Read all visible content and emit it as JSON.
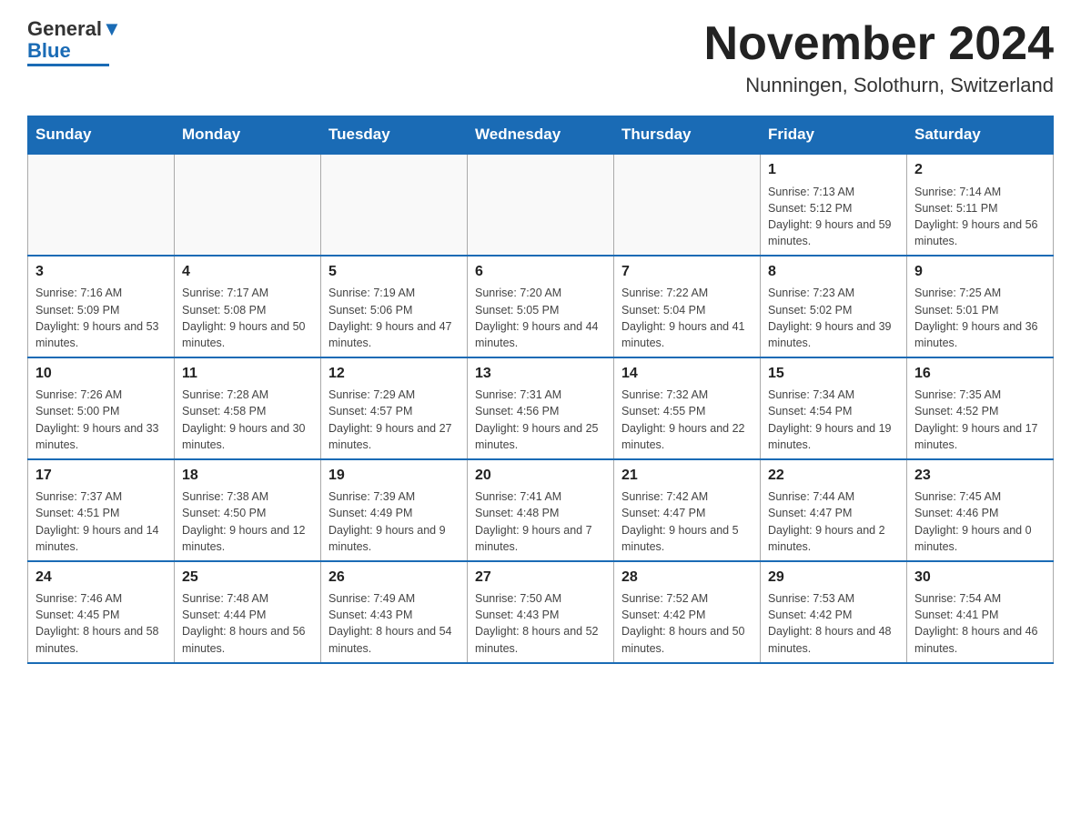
{
  "header": {
    "logo_text_black": "General",
    "logo_text_blue": "Blue",
    "month_title": "November 2024",
    "location": "Nunningen, Solothurn, Switzerland"
  },
  "weekdays": [
    "Sunday",
    "Monday",
    "Tuesday",
    "Wednesday",
    "Thursday",
    "Friday",
    "Saturday"
  ],
  "weeks": [
    [
      {
        "day": "",
        "sunrise": "",
        "sunset": "",
        "daylight": ""
      },
      {
        "day": "",
        "sunrise": "",
        "sunset": "",
        "daylight": ""
      },
      {
        "day": "",
        "sunrise": "",
        "sunset": "",
        "daylight": ""
      },
      {
        "day": "",
        "sunrise": "",
        "sunset": "",
        "daylight": ""
      },
      {
        "day": "",
        "sunrise": "",
        "sunset": "",
        "daylight": ""
      },
      {
        "day": "1",
        "sunrise": "Sunrise: 7:13 AM",
        "sunset": "Sunset: 5:12 PM",
        "daylight": "Daylight: 9 hours and 59 minutes."
      },
      {
        "day": "2",
        "sunrise": "Sunrise: 7:14 AM",
        "sunset": "Sunset: 5:11 PM",
        "daylight": "Daylight: 9 hours and 56 minutes."
      }
    ],
    [
      {
        "day": "3",
        "sunrise": "Sunrise: 7:16 AM",
        "sunset": "Sunset: 5:09 PM",
        "daylight": "Daylight: 9 hours and 53 minutes."
      },
      {
        "day": "4",
        "sunrise": "Sunrise: 7:17 AM",
        "sunset": "Sunset: 5:08 PM",
        "daylight": "Daylight: 9 hours and 50 minutes."
      },
      {
        "day": "5",
        "sunrise": "Sunrise: 7:19 AM",
        "sunset": "Sunset: 5:06 PM",
        "daylight": "Daylight: 9 hours and 47 minutes."
      },
      {
        "day": "6",
        "sunrise": "Sunrise: 7:20 AM",
        "sunset": "Sunset: 5:05 PM",
        "daylight": "Daylight: 9 hours and 44 minutes."
      },
      {
        "day": "7",
        "sunrise": "Sunrise: 7:22 AM",
        "sunset": "Sunset: 5:04 PM",
        "daylight": "Daylight: 9 hours and 41 minutes."
      },
      {
        "day": "8",
        "sunrise": "Sunrise: 7:23 AM",
        "sunset": "Sunset: 5:02 PM",
        "daylight": "Daylight: 9 hours and 39 minutes."
      },
      {
        "day": "9",
        "sunrise": "Sunrise: 7:25 AM",
        "sunset": "Sunset: 5:01 PM",
        "daylight": "Daylight: 9 hours and 36 minutes."
      }
    ],
    [
      {
        "day": "10",
        "sunrise": "Sunrise: 7:26 AM",
        "sunset": "Sunset: 5:00 PM",
        "daylight": "Daylight: 9 hours and 33 minutes."
      },
      {
        "day": "11",
        "sunrise": "Sunrise: 7:28 AM",
        "sunset": "Sunset: 4:58 PM",
        "daylight": "Daylight: 9 hours and 30 minutes."
      },
      {
        "day": "12",
        "sunrise": "Sunrise: 7:29 AM",
        "sunset": "Sunset: 4:57 PM",
        "daylight": "Daylight: 9 hours and 27 minutes."
      },
      {
        "day": "13",
        "sunrise": "Sunrise: 7:31 AM",
        "sunset": "Sunset: 4:56 PM",
        "daylight": "Daylight: 9 hours and 25 minutes."
      },
      {
        "day": "14",
        "sunrise": "Sunrise: 7:32 AM",
        "sunset": "Sunset: 4:55 PM",
        "daylight": "Daylight: 9 hours and 22 minutes."
      },
      {
        "day": "15",
        "sunrise": "Sunrise: 7:34 AM",
        "sunset": "Sunset: 4:54 PM",
        "daylight": "Daylight: 9 hours and 19 minutes."
      },
      {
        "day": "16",
        "sunrise": "Sunrise: 7:35 AM",
        "sunset": "Sunset: 4:52 PM",
        "daylight": "Daylight: 9 hours and 17 minutes."
      }
    ],
    [
      {
        "day": "17",
        "sunrise": "Sunrise: 7:37 AM",
        "sunset": "Sunset: 4:51 PM",
        "daylight": "Daylight: 9 hours and 14 minutes."
      },
      {
        "day": "18",
        "sunrise": "Sunrise: 7:38 AM",
        "sunset": "Sunset: 4:50 PM",
        "daylight": "Daylight: 9 hours and 12 minutes."
      },
      {
        "day": "19",
        "sunrise": "Sunrise: 7:39 AM",
        "sunset": "Sunset: 4:49 PM",
        "daylight": "Daylight: 9 hours and 9 minutes."
      },
      {
        "day": "20",
        "sunrise": "Sunrise: 7:41 AM",
        "sunset": "Sunset: 4:48 PM",
        "daylight": "Daylight: 9 hours and 7 minutes."
      },
      {
        "day": "21",
        "sunrise": "Sunrise: 7:42 AM",
        "sunset": "Sunset: 4:47 PM",
        "daylight": "Daylight: 9 hours and 5 minutes."
      },
      {
        "day": "22",
        "sunrise": "Sunrise: 7:44 AM",
        "sunset": "Sunset: 4:47 PM",
        "daylight": "Daylight: 9 hours and 2 minutes."
      },
      {
        "day": "23",
        "sunrise": "Sunrise: 7:45 AM",
        "sunset": "Sunset: 4:46 PM",
        "daylight": "Daylight: 9 hours and 0 minutes."
      }
    ],
    [
      {
        "day": "24",
        "sunrise": "Sunrise: 7:46 AM",
        "sunset": "Sunset: 4:45 PM",
        "daylight": "Daylight: 8 hours and 58 minutes."
      },
      {
        "day": "25",
        "sunrise": "Sunrise: 7:48 AM",
        "sunset": "Sunset: 4:44 PM",
        "daylight": "Daylight: 8 hours and 56 minutes."
      },
      {
        "day": "26",
        "sunrise": "Sunrise: 7:49 AM",
        "sunset": "Sunset: 4:43 PM",
        "daylight": "Daylight: 8 hours and 54 minutes."
      },
      {
        "day": "27",
        "sunrise": "Sunrise: 7:50 AM",
        "sunset": "Sunset: 4:43 PM",
        "daylight": "Daylight: 8 hours and 52 minutes."
      },
      {
        "day": "28",
        "sunrise": "Sunrise: 7:52 AM",
        "sunset": "Sunset: 4:42 PM",
        "daylight": "Daylight: 8 hours and 50 minutes."
      },
      {
        "day": "29",
        "sunrise": "Sunrise: 7:53 AM",
        "sunset": "Sunset: 4:42 PM",
        "daylight": "Daylight: 8 hours and 48 minutes."
      },
      {
        "day": "30",
        "sunrise": "Sunrise: 7:54 AM",
        "sunset": "Sunset: 4:41 PM",
        "daylight": "Daylight: 8 hours and 46 minutes."
      }
    ]
  ]
}
